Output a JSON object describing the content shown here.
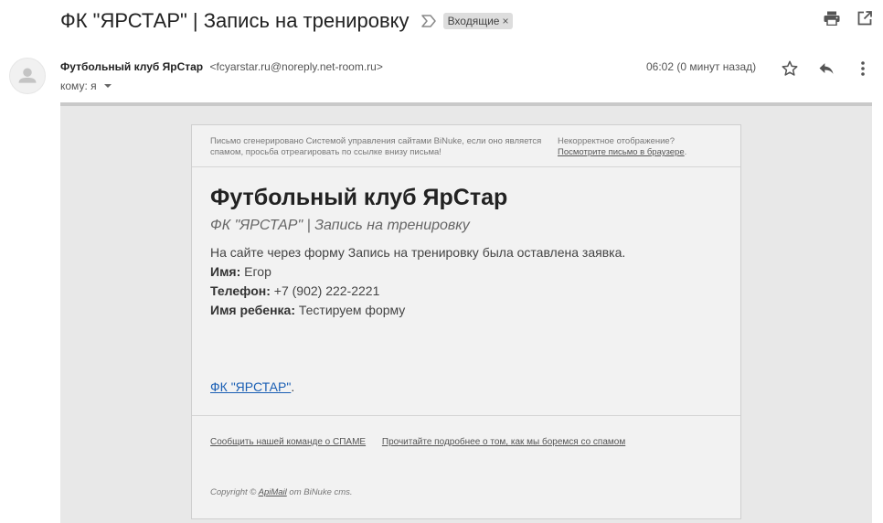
{
  "header": {
    "subject": "ФК \"ЯРСТАР\" | Запись на тренировку",
    "label": "Входящие",
    "label_remove": "×"
  },
  "message": {
    "sender_name": "Футбольный клуб ЯрСтар",
    "sender_email": "<fcyarstar.ru@noreply.net-room.ru>",
    "to_label": "кому: я",
    "time": "06:02 (0 минут назад)"
  },
  "email": {
    "pre_header_left": "Письмо сгенерировано Системой управления сайтами BiNuke, если оно является спамом, просьба отреагировать по ссылке внизу письма!",
    "pre_header_right_text": "Некорректное отображение?",
    "pre_header_right_link": "Посмотрите письмо в браузере",
    "pre_header_right_dot": ".",
    "title": "Футбольный клуб ЯрСтар",
    "subtitle": "ФК \"ЯРСТАР\" | Запись на тренировку",
    "intro": "На сайте через форму Запись на тренировку была оставлена заявка.",
    "fields": [
      {
        "label": "Имя:",
        "value": "Егор"
      },
      {
        "label": "Телефон:",
        "value": "+7 (902) 222-2221"
      },
      {
        "label": "Имя ребенка:",
        "value": "Тестируем форму"
      }
    ],
    "signature_link": "ФК \"ЯРСТАР\"",
    "signature_dot": ".",
    "spam_link": "Сообщить нашей команде о СПАМЕ",
    "spam_info_link": "Прочитайте подробнее о том, как мы боремся со спамом",
    "copyright_prefix": "Copyright ©",
    "copyright_link": "ApiMail",
    "copyright_suffix": "от BiNuke cms."
  },
  "icons": {
    "importance": "importance-marker-icon",
    "print": "print-icon",
    "open_new_window": "open-in-new-window-icon",
    "star": "star-icon",
    "reply": "reply-icon",
    "more": "more-vert-icon",
    "avatar": "default-avatar-icon"
  }
}
